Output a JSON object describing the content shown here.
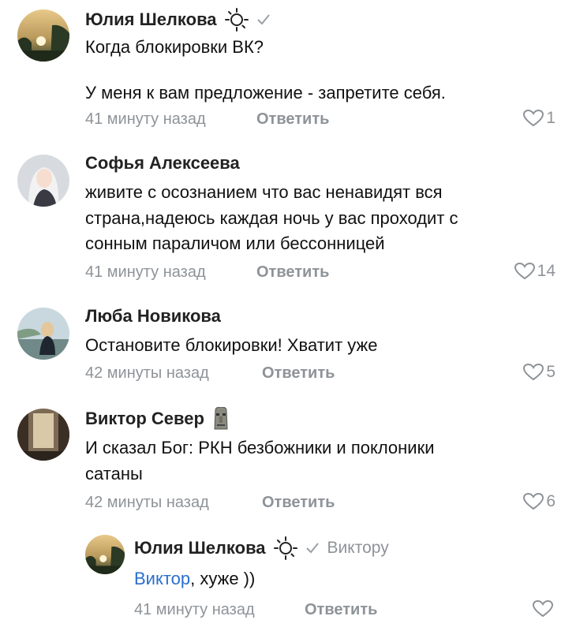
{
  "colors": {
    "link": "#2a6fcf",
    "meta": "#8e9398",
    "text": "#111111"
  },
  "comments": [
    {
      "author": "Юлия Шелкова",
      "status_icon": "sun-emoji-icon",
      "verified_icon": "checkmark-icon",
      "lines": [
        "Когда блокировки ВК?",
        "У меня к вам предложение - запретите себя."
      ],
      "time": "41 минуту назад",
      "reply_label": "Ответить",
      "likes": "1"
    },
    {
      "author": "Софья Алексеева",
      "lines": [
        "живите с осознанием что вас ненавидят вся",
        "страна,надеюсь каждая ночь у вас проходит с",
        "сонным параличом или бессонницей"
      ],
      "time": "41 минуту назад",
      "reply_label": "Ответить",
      "likes": "14"
    },
    {
      "author": "Люба Новикова",
      "lines": [
        "Остановите блокировки! Хватит уже"
      ],
      "time": "42 минуты назад",
      "reply_label": "Ответить",
      "likes": "5"
    },
    {
      "author": "Виктор Север",
      "status_icon": "moai-emoji-icon",
      "lines": [
        "И сказал Бог: РКН безбожники и поклоники",
        "сатаны"
      ],
      "time": "42 минуты назад",
      "reply_label": "Ответить",
      "likes": "6"
    }
  ],
  "reply": {
    "author": "Юлия Шелкова",
    "status_icon": "sun-emoji-icon",
    "verified_icon": "checkmark-icon",
    "to_user": "Виктору",
    "mention": "Виктор",
    "text_rest": ", хуже ))",
    "time": "41 минуту назад",
    "reply_label": "Ответить",
    "likes": ""
  }
}
